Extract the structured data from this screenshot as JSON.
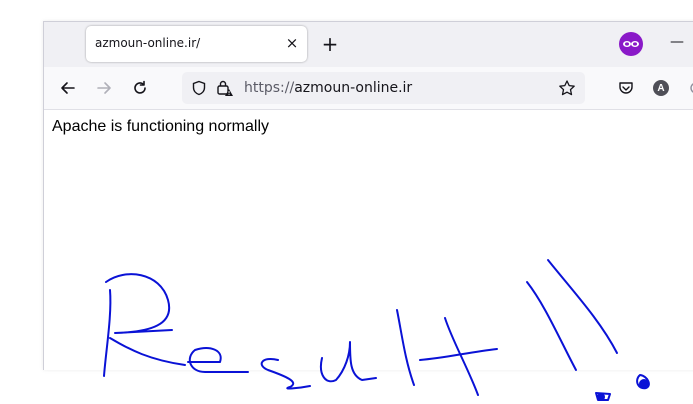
{
  "tab": {
    "title": "azmoun-online.ir/",
    "close_glyph": "×"
  },
  "tabstrip": {
    "new_tab_glyph": "+",
    "minimize_glyph": "—"
  },
  "navbar": {
    "back_icon": "arrow-left-icon",
    "forward_icon": "arrow-right-icon",
    "reload_icon": "reload-icon",
    "url_protocol": "https://",
    "url_host": "azmoun-online.ir",
    "avatar_letter": "A"
  },
  "page": {
    "text": "Apache is functioning normally"
  },
  "annotation": {
    "color": "#0a12d6"
  },
  "colors": {
    "private_mask": "#8a19c8",
    "tabstrip_bg": "#f0f0f4"
  }
}
